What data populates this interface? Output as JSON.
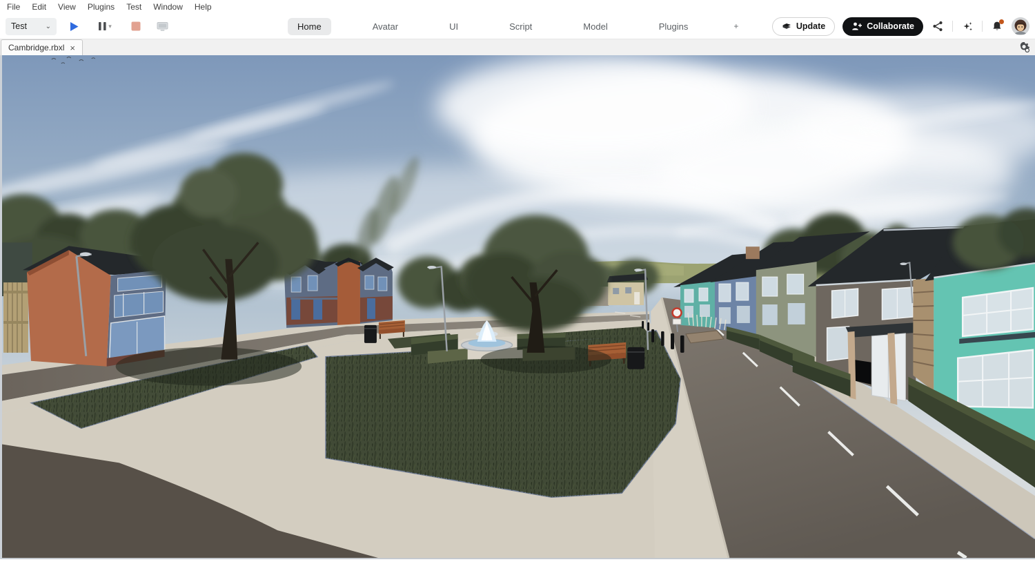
{
  "menu_bar": {
    "items": [
      "File",
      "Edit",
      "View",
      "Plugins",
      "Test",
      "Window",
      "Help"
    ]
  },
  "toolbar": {
    "mode_selector": {
      "value": "Test",
      "chevron_glyph": "⌄"
    },
    "pause_chevron_glyph": "▾"
  },
  "ribbon": {
    "tabs": [
      {
        "label": "Home"
      },
      {
        "label": "Avatar"
      },
      {
        "label": "UI"
      },
      {
        "label": "Script"
      },
      {
        "label": "Model"
      },
      {
        "label": "Plugins"
      }
    ],
    "overflow_label": "+"
  },
  "header_actions": {
    "update_label": "Update",
    "collaborate_label": "Collaborate"
  },
  "tab_strip": {
    "document_tab": {
      "label": "Cambridge.rbxl",
      "close_glyph": "×"
    }
  },
  "scene": {
    "colors": {
      "skyTop": "#7e98ba",
      "skyMid": "#a9bccd",
      "skyHorizon": "#d8dde0",
      "hills": "#99a06b",
      "treeDark": "#39432f",
      "treeMid": "#49543d",
      "treeLight": "#5a6549",
      "grassBase": "#414a36",
      "pathLight": "#d3cdc0",
      "pathDark": "#575048",
      "sideRoad": "#7d766c",
      "road": "#6e675e",
      "roofDark": "#24282b",
      "brick": "#a55c39",
      "brickGable": "#b36b4a",
      "wallBlue": "#5e6c84",
      "windowBlue": "#7191b8",
      "wallTeal": "#5fb0a5",
      "wallBlueHouse": "#6d84a6",
      "wallSage": "#8d947e",
      "wallGray": "#6e675f",
      "wallTurquoise": "#64c4b2",
      "quoin": "#a8906f",
      "hedge": "#333d2b",
      "hedgeTop": "#4d583c",
      "bench": "#a65f35",
      "bin": "#17181a",
      "fountainWater": "#dceefc",
      "stone": "#c8cdd1",
      "lamp": "#b9bfc4",
      "curb": "#97a1b4",
      "dash": "#f2f3f1",
      "tanHouse": "#cfc4a4",
      "accentPlay": "#2f6bdf",
      "stopDisabled": "#e2a291",
      "notificationDot": "#c2571c"
    }
  }
}
